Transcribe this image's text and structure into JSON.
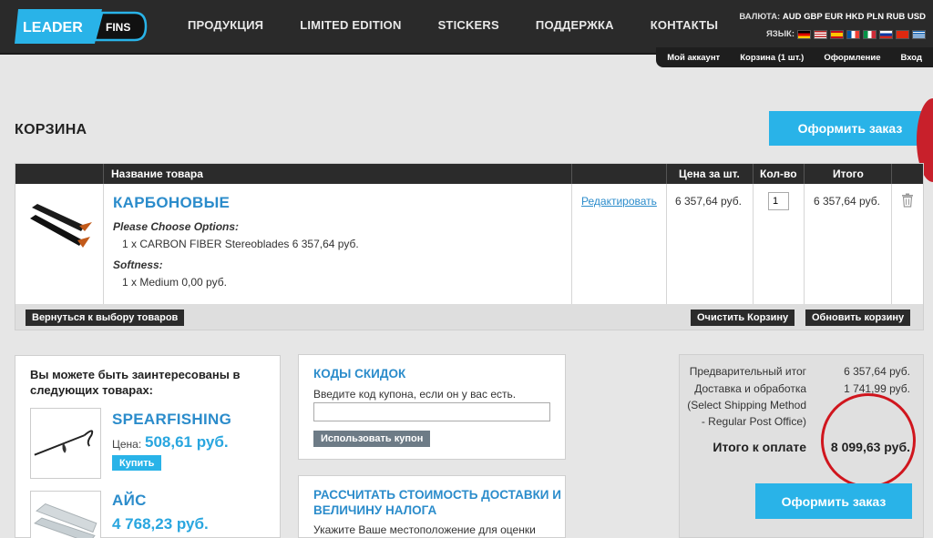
{
  "header": {
    "logo_left": "LEADER",
    "logo_right": "FINS",
    "nav": [
      "ПРОДУКЦИЯ",
      "LIMITED EDITION",
      "STICKERS",
      "ПОДДЕРЖКА",
      "КОНТАКТЫ"
    ],
    "currency_label": "ВАЛЮТА:",
    "currencies": "AUD GBP EUR HKD PLN RUB USD",
    "language_label": "ЯЗЫК:",
    "account_links": [
      "Мой аккаунт",
      "Корзина (1 шт.)",
      "Оформление",
      "Вход"
    ]
  },
  "page": {
    "title": "КОРЗИНА",
    "checkout_button": "Оформить заказ"
  },
  "cart": {
    "headers": [
      "Название товара",
      "Цена за шт.",
      "Кол-во",
      "Итого"
    ],
    "item": {
      "name": "КАРБОНОВЫЕ",
      "options_label_1": "Please Choose Options:",
      "options_value_1": "1 x CARBON FIBER Stereoblades 6 357,64 руб.",
      "options_label_2": "Softness:",
      "options_value_2": "1 x Medium 0,00 руб.",
      "edit": "Редактировать",
      "unit_price": "6 357,64 руб.",
      "qty": "1",
      "total": "6 357,64 руб."
    },
    "back_button": "Вернуться к выбору товаров",
    "clear_button": "Очистить Корзину",
    "update_button": "Обновить корзину"
  },
  "recommend": {
    "title_line1": "Вы можете быть заинтересованы в",
    "title_line2": "следующих товарах:",
    "items": [
      {
        "name": "SPEARFISHING",
        "price_label": "Цена:",
        "price": "508,61 руб.",
        "buy": "Купить"
      },
      {
        "name": "АЙС",
        "price": "4 768,23 руб."
      }
    ]
  },
  "coupon": {
    "title": "КОДЫ СКИДОК",
    "text": "Введите код купона, если он у вас есть.",
    "button": "Использовать купон"
  },
  "shipping": {
    "title_line1": "РАССЧИТАТЬ СТОИМОСТЬ ДОСТАВКИ И",
    "title_line2": "ВЕЛИЧИНУ НАЛОГА",
    "text": "Укажите Ваше местоположение для оценки"
  },
  "totals": {
    "subtotal_label": "Предварительный итог",
    "subtotal": "6 357,64 руб.",
    "shipping_label": "Доставка и обработка",
    "shipping": "1 741,99 руб.",
    "shipping_note1": "(Select Shipping Method",
    "shipping_note2": "- Regular Post Office)",
    "grand_label": "Итого к оплате",
    "grand": "8 099,63 руб.",
    "checkout_button": "Оформить заказ"
  },
  "colors": {
    "accent": "#29b3e8",
    "link": "#2b8ccb",
    "header_bg": "#2a2a2a",
    "annotation_red": "#d0161e"
  }
}
